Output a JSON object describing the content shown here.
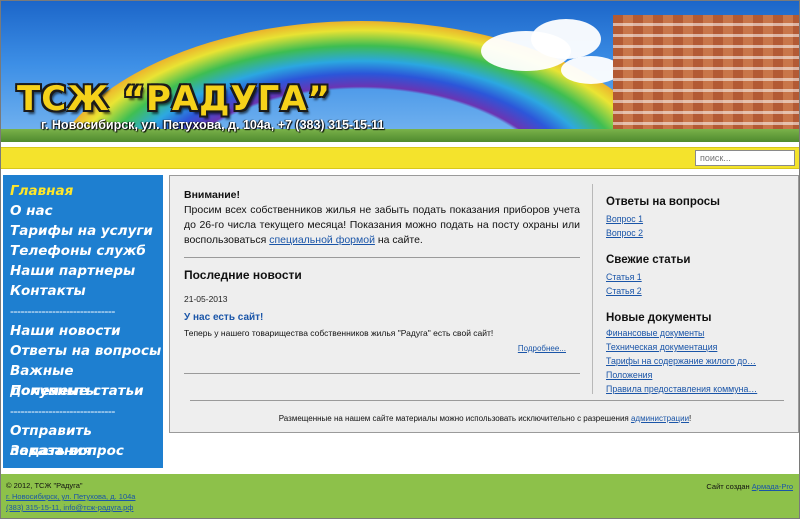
{
  "header": {
    "title": "ТСЖ “РАДУГА”",
    "address": "г. Новосибирск, ул. Петухова, д. 104а, +7 (383) 315-15-11"
  },
  "search": {
    "placeholder": "поиск..."
  },
  "sidebar": {
    "items": [
      {
        "label": "Главная",
        "active": true
      },
      {
        "label": "О нас"
      },
      {
        "label": "Тарифы на услуги"
      },
      {
        "label": "Телефоны служб"
      },
      {
        "label": "Наши партнеры"
      },
      {
        "label": "Контакты"
      },
      {
        "separator": "------------------------------"
      },
      {
        "label": "Наши новости"
      },
      {
        "label": "Ответы на вопросы"
      },
      {
        "label": "Важные документы"
      },
      {
        "label": "Полезные статьи"
      },
      {
        "separator": "------------------------------"
      },
      {
        "label": "Отправить показания"
      },
      {
        "label": "Задать вопрос"
      }
    ],
    "separator": "------------------------------"
  },
  "notice": {
    "title": "Внимание!",
    "text_before": "Просим всех собственников жилья не забыть подать показания приборов учета до 26-го числа текущего месяца! Показания можно подать на посту охраны или воспользоваться ",
    "link": "специальной формой",
    "text_after": " на сайте."
  },
  "news": {
    "heading": "Последние новости",
    "date": "21-05-2013",
    "title": "У нас есть сайт!",
    "text": "Теперь у нашего товарищества собственников жилья \"Радуга\" есть свой сайт!",
    "more": "Подробнее..."
  },
  "right": {
    "qa_heading": "Ответы на вопросы",
    "qa": [
      "Вопрос 1",
      "Вопрос 2"
    ],
    "articles_heading": "Свежие статьи",
    "articles": [
      "Статья 1",
      "Статья 2"
    ],
    "docs_heading": "Новые документы",
    "docs": [
      "Финансовые документы",
      "Техническая документация",
      "Тарифы на содержание жилого до…",
      "Положения",
      "Правила предоставления коммуна…"
    ]
  },
  "disclaimer": {
    "text": "Размещенные на нашем сайте материалы можно использовать исключительно с разрешения ",
    "link": "администрации",
    "end": "!"
  },
  "footer": {
    "copyright": "© 2012, ТСЖ \"Радуга\"",
    "address": "г. Новосибирск, ул. Петухова, д. 104а",
    "contacts": "(383) 315-15-11, info@тсж-радуга.рф",
    "created_label": "Сайт создан ",
    "created_link": "Армада-Pro"
  }
}
